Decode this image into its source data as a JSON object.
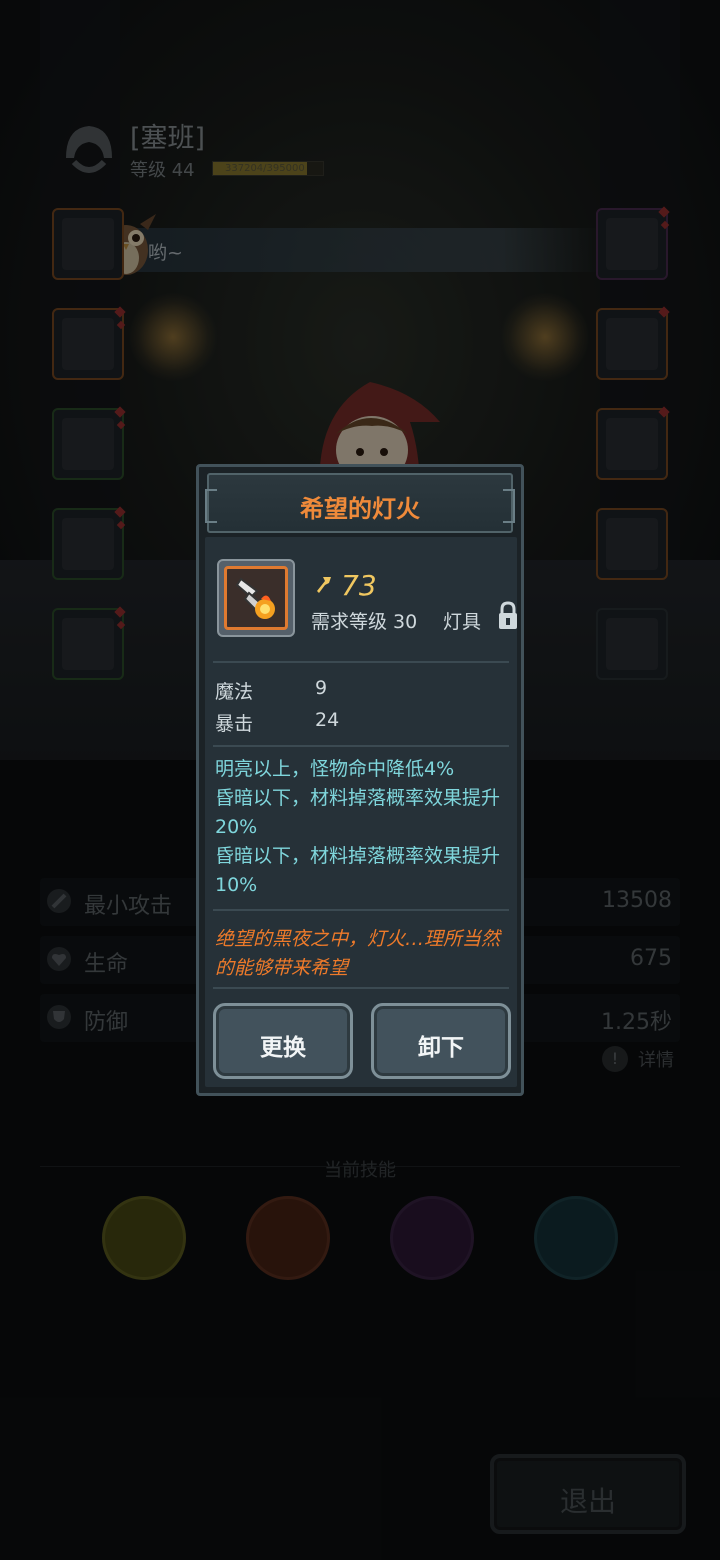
{
  "player": {
    "name": "[塞班]",
    "level": "等级 44",
    "exp_text": "337204/395000",
    "exp_fraction": 0.853
  },
  "speech": {
    "text": "哟~"
  },
  "stats": [
    {
      "icon": "sword-icon",
      "label": "最小攻击",
      "value": "13508"
    },
    {
      "icon": "heart-icon",
      "label": "生命",
      "value": "675"
    },
    {
      "icon": "shield-icon",
      "label": "防御",
      "value": "1.25秒"
    }
  ],
  "details_label": "详情",
  "skills_title": "当前技能",
  "exit_label": "退出",
  "item": {
    "title": "希望的灯火",
    "power": "73",
    "required_level": "需求等级 30",
    "type": "灯具",
    "attributes": [
      {
        "label": "魔法",
        "value": "9"
      },
      {
        "label": "暴击",
        "value": "24"
      }
    ],
    "effects": [
      "明亮以上，怪物命中降低4%",
      "昏暗以下，材料掉落概率效果提升20%",
      "昏暗以下，材料掉落概率效果提升10%"
    ],
    "flavor": "绝望的黑夜之中，灯火…理所当然的能够带来希望",
    "replace_label": "更换",
    "unequip_label": "卸下"
  },
  "colors": {
    "title_orange": "#ef8a3a",
    "power_gold": "#f0c760",
    "effect_cyan": "#7fd6dc",
    "flavor_orange": "#ee7a2a"
  }
}
